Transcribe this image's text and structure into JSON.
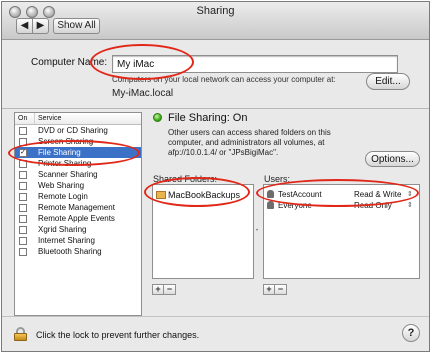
{
  "window": {
    "title": "Sharing",
    "back_glyph": "◀",
    "forward_glyph": "▶",
    "show_all_label": "Show All"
  },
  "computer_name": {
    "label": "Computer Name:",
    "value": "My iMac",
    "description": "Computers on your local network can access your computer at:",
    "local_address": "My-iMac.local",
    "edit_label": "Edit..."
  },
  "services": {
    "col_on": "On",
    "col_service": "Service",
    "items": [
      {
        "name": "DVD or CD Sharing",
        "on": false
      },
      {
        "name": "Screen Sharing",
        "on": false
      },
      {
        "name": "File Sharing",
        "on": true,
        "selected": true
      },
      {
        "name": "Printer Sharing",
        "on": false
      },
      {
        "name": "Scanner Sharing",
        "on": false
      },
      {
        "name": "Web Sharing",
        "on": false
      },
      {
        "name": "Remote Login",
        "on": false
      },
      {
        "name": "Remote Management",
        "on": false
      },
      {
        "name": "Remote Apple Events",
        "on": false
      },
      {
        "name": "Xgrid Sharing",
        "on": false
      },
      {
        "name": "Internet Sharing",
        "on": false
      },
      {
        "name": "Bluetooth Sharing",
        "on": false
      }
    ],
    "check_glyph": "✓"
  },
  "status": {
    "text": "File Sharing: On",
    "info": "Other users can access shared folders on this computer, and administrators all volumes, at afp://10.0.1.4/ or \"JPsBigiMac\".",
    "options_label": "Options..."
  },
  "shared_folders": {
    "label": "Shared Folders:",
    "items": [
      "MacBookBackups"
    ]
  },
  "users": {
    "label": "Users:",
    "items": [
      {
        "name": "TestAccount",
        "permission": "Read & Write",
        "arrow": "⇕"
      },
      {
        "name": "Everyone",
        "permission": "Read Only",
        "arrow": "⇕"
      }
    ]
  },
  "buttons": {
    "add": "+",
    "remove": "−",
    "splitter": "•"
  },
  "lock": {
    "text": "Click the lock to prevent further changes."
  },
  "help": {
    "label": "?"
  },
  "colors": {
    "annotation": "#e02718",
    "selection": "#3b72c8",
    "status_green": "#3fae17"
  }
}
